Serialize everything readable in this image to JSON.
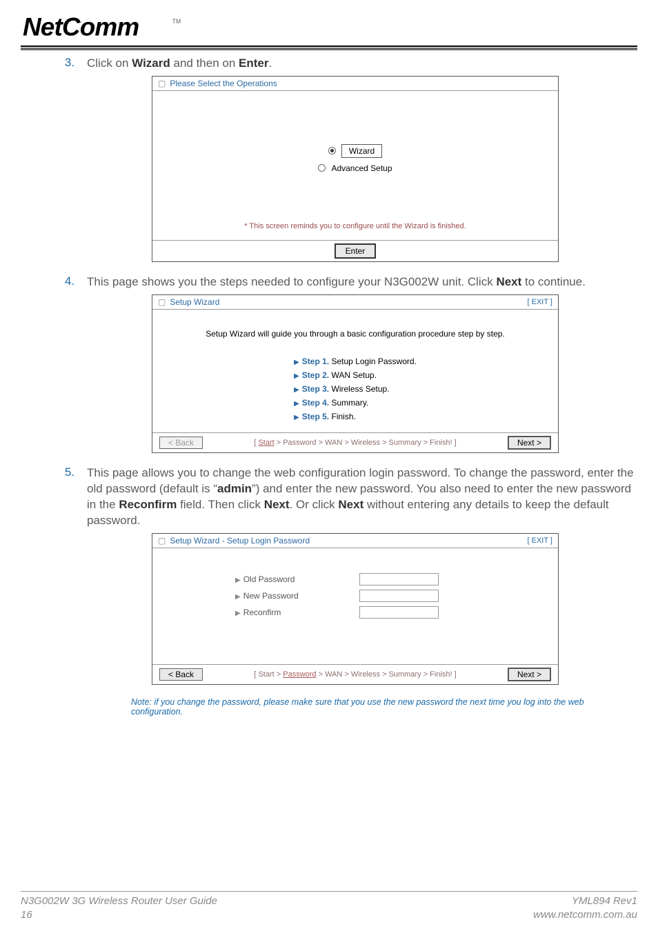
{
  "brand": {
    "name": "NetComm",
    "tm": "TM"
  },
  "items": {
    "i3": {
      "num": "3.",
      "pre": "Click on ",
      "b1": "Wizard",
      "mid": " and then on ",
      "b2": "Enter",
      "post": "."
    },
    "i4": {
      "num": "4.",
      "pre": "This page shows you the steps needed to configure your N3G002W unit. Click ",
      "b1": "Next",
      "post": " to continue."
    },
    "i5": {
      "num": "5.",
      "line1a": "This page allows you to change the web configuration login password. To change the password, enter the old password (default is “",
      "line1b": "admin",
      "line1c": "”) and enter the new password. You also need to enter the new password in the ",
      "line2a": "Reconfirm",
      "line2b": " field. Then click ",
      "line2c": "Next",
      "line2d": ". Or click ",
      "line2e": "Next",
      "line2f": " without entering any details to keep the default password."
    }
  },
  "panel1": {
    "title": "Please Select the Operations",
    "wizard": "Wizard",
    "advanced": "Advanced Setup",
    "reminder": "* This screen reminds you to configure until the Wizard is finished.",
    "enter": "Enter"
  },
  "panel2": {
    "title": "Setup Wizard",
    "exit": "[ EXIT ]",
    "intro": "Setup Wizard will guide you through a basic configuration procedure step by step.",
    "steps": {
      "s1": {
        "n": "Step 1.",
        "t": " Setup Login Password."
      },
      "s2": {
        "n": "Step 2.",
        "t": " WAN Setup."
      },
      "s3": {
        "n": "Step 3.",
        "t": " Wireless Setup."
      },
      "s4": {
        "n": "Step 4.",
        "t": " Summary."
      },
      "s5": {
        "n": "Step 5.",
        "t": " Finish."
      }
    },
    "back": "< Back",
    "crumb": {
      "open": "[ ",
      "start": "Start",
      "rest": " > Password > WAN > Wireless > Summary > Finish! ]"
    },
    "next": "Next >"
  },
  "panel3": {
    "title": "Setup Wizard - Setup Login Password",
    "exit": "[ EXIT ]",
    "oldpw": "Old Password",
    "newpw": "New Password",
    "reconfirm": "Reconfirm",
    "back": "< Back",
    "crumb": {
      "open": "[ Start > ",
      "cur": "Password",
      "rest": " > WAN > Wireless > Summary > Finish! ]"
    },
    "next": "Next >"
  },
  "note": "Note: if you change the password, please make sure that you use the new password the next time you log into the web configuration.",
  "footer": {
    "left1": "N3G002W 3G Wireless Router User Guide",
    "left2": "16",
    "right1": "YML894 Rev1",
    "right2": "www.netcomm.com.au"
  }
}
